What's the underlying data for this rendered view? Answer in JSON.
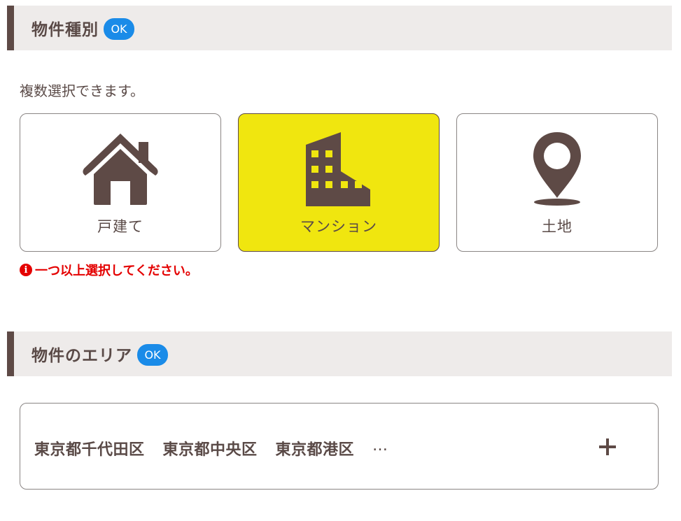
{
  "section1": {
    "title": "物件種別",
    "badge": "OK",
    "hint": "複数選択できます。",
    "options": [
      {
        "label": "戸建て",
        "icon": "house-icon",
        "selected": false
      },
      {
        "label": "マンション",
        "icon": "building-icon",
        "selected": true
      },
      {
        "label": "土地",
        "icon": "map-pin-icon",
        "selected": false
      }
    ],
    "error": "一つ以上選択してください。"
  },
  "section2": {
    "title": "物件のエリア",
    "badge": "OK",
    "areas": [
      "東京都千代田区",
      "東京都中央区",
      "東京都港区"
    ],
    "more": "…"
  },
  "colors": {
    "accent_bar": "#5e4a46",
    "header_bg": "#eeebea",
    "badge": "#1a8be8",
    "selected_card": "#f0e60f",
    "text": "#5a4a47",
    "error": "#e40000"
  }
}
